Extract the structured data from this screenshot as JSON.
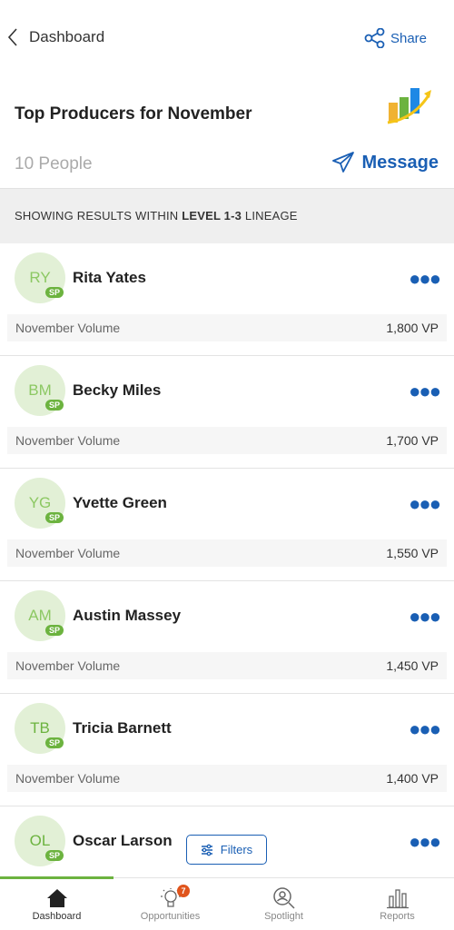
{
  "nav": {
    "back_label": "Dashboard",
    "share_label": "Share"
  },
  "header": {
    "title": "Top Producers for November",
    "people_count": "10 People",
    "message_label": "Message"
  },
  "banner": {
    "prefix": "SHOWING RESULTS WITHIN ",
    "bold": "LEVEL 1-3",
    "suffix": " LINEAGE"
  },
  "people": [
    {
      "initials": "RY",
      "badge": "SP",
      "name": "Rita Yates",
      "volume_label": "November Volume",
      "volume": "1,800 VP"
    },
    {
      "initials": "BM",
      "badge": "SP",
      "name": "Becky Miles",
      "volume_label": "November Volume",
      "volume": "1,700 VP"
    },
    {
      "initials": "YG",
      "badge": "SP",
      "name": "Yvette Green",
      "volume_label": "November Volume",
      "volume": "1,550 VP"
    },
    {
      "initials": "AM",
      "badge": "SP",
      "name": "Austin Massey",
      "volume_label": "November Volume",
      "volume": "1,450 VP"
    },
    {
      "initials": "TB",
      "badge": "SP",
      "name": "Tricia Barnett",
      "volume_label": "November Volume",
      "volume": "1,400 VP"
    },
    {
      "initials": "OL",
      "badge": "SP",
      "name": "Oscar Larson"
    }
  ],
  "filters_label": "Filters",
  "tabs": [
    {
      "label": "Dashboard",
      "icon": "home-icon"
    },
    {
      "label": "Opportunities",
      "icon": "lightbulb-icon",
      "badge": "7"
    },
    {
      "label": "Spotlight",
      "icon": "spotlight-icon"
    },
    {
      "label": "Reports",
      "icon": "bar-chart-icon"
    }
  ],
  "colors": {
    "accent": "#1a5fb4",
    "brand_green": "#6cb33f",
    "badge": "#e0541c"
  }
}
